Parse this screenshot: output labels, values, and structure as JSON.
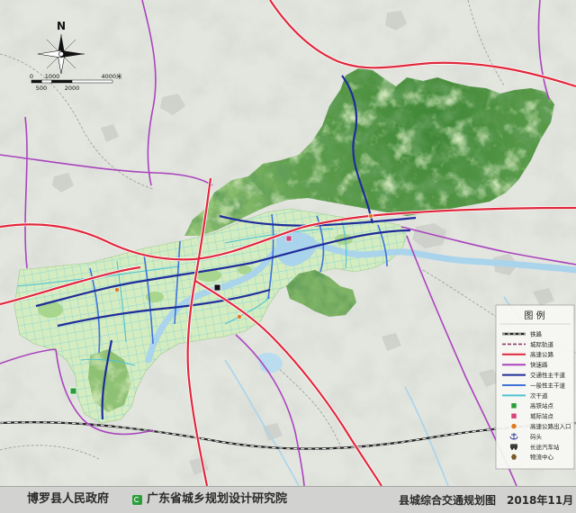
{
  "map": {
    "north_label": "N",
    "scale_bar": {
      "top_labels": [
        "0",
        "1000",
        "4000米"
      ],
      "bottom_labels": [
        "500",
        "2000"
      ]
    },
    "legend": {
      "title": "图 例",
      "items": [
        {
          "label": "铁路",
          "icon": "railway-line-icon",
          "color": "#222222"
        },
        {
          "label": "城际轨道",
          "icon": "dashed-line-icon",
          "color": "#8e3b6b"
        },
        {
          "label": "高速公路",
          "icon": "solid-line-icon",
          "color": "#e0283c"
        },
        {
          "label": "快速路",
          "icon": "solid-line-icon",
          "color": "#a944bd"
        },
        {
          "label": "交通性主干道",
          "icon": "solid-line-icon",
          "color": "#1f2d9a"
        },
        {
          "label": "一般性主干道",
          "icon": "solid-line-icon",
          "color": "#3f74db"
        },
        {
          "label": "次干道",
          "icon": "solid-line-icon",
          "color": "#4fc4d4"
        },
        {
          "label": "高铁站点",
          "icon": "square-icon",
          "color": "#2a9d3a"
        },
        {
          "label": "城际站点",
          "icon": "square-icon",
          "color": "#d6457a"
        },
        {
          "label": "高速公路出入口",
          "icon": "circle-icon",
          "color": "#e07a1f"
        },
        {
          "label": "码头",
          "icon": "anchor-icon",
          "color": "#1f2d9a"
        },
        {
          "label": "长途汽车站",
          "icon": "bus-icon",
          "color": "#3a3a3a"
        },
        {
          "label": "物流中心",
          "icon": "hexagon-icon",
          "color": "#7a5a2a"
        }
      ]
    }
  },
  "footer": {
    "government": "博罗县人民政府",
    "institute": "广东省城乡规划设计研究院",
    "map_title": "县城综合交通规划图",
    "date": "2018年11月"
  },
  "colors": {
    "mountain": "#5e9e4c",
    "urban_area": "#d4ecbf",
    "river": "#a9d4ec",
    "expressway": "#e0283c",
    "fast_road": "#a944bd",
    "traffic_main_road": "#1f2d9a",
    "general_main_road": "#3f74db",
    "secondary_road": "#4fc4d4",
    "footer_background": "#d2d3d0"
  },
  "icons": {
    "north_arrow": "north-arrow-icon",
    "institute_logo": "institute-logo-icon"
  }
}
